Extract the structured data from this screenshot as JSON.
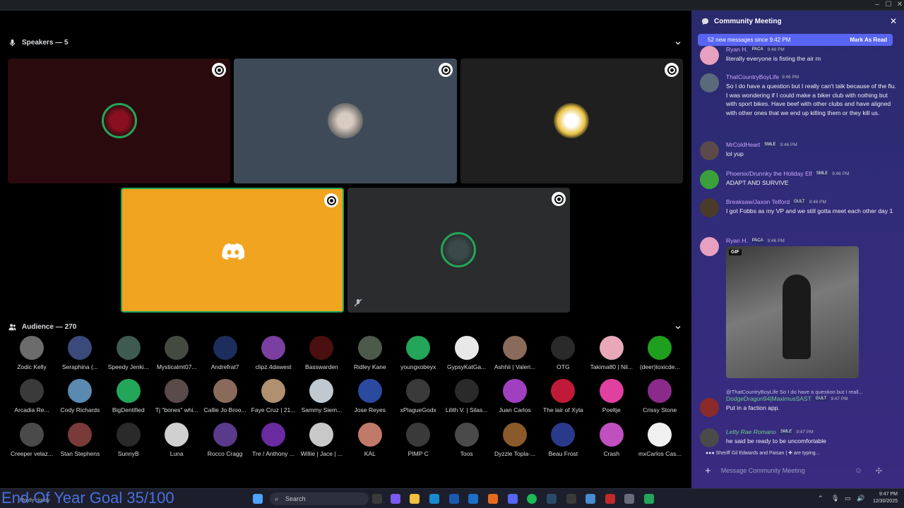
{
  "window": {
    "controls": [
      "–",
      "☐",
      "✕"
    ]
  },
  "speakers": {
    "label": "Speakers — 5"
  },
  "audience": {
    "label": "Audience — 270",
    "members": [
      {
        "name": "Zodic Kelly",
        "color": "#6c6c6c"
      },
      {
        "name": "Seraphina (...",
        "color": "#3a4a7a"
      },
      {
        "name": "Speedy Jenki...",
        "color": "#3f5a50"
      },
      {
        "name": "Mysticalmt07...",
        "color": "#444a40"
      },
      {
        "name": "Andrefrat7",
        "color": "#1d2d5c"
      },
      {
        "name": "clipz.4dawest",
        "color": "#7a3fa0"
      },
      {
        "name": "Basswarden",
        "color": "#4a1010"
      },
      {
        "name": "Ridley Kane",
        "color": "#4c5a4c"
      },
      {
        "name": "youngxobeyx",
        "color": "#23a55a"
      },
      {
        "name": "GypsyKatGa...",
        "color": "#e8e8e8"
      },
      {
        "name": "Ashhii | Valeri...",
        "color": "#8a6a5a"
      },
      {
        "name": "OTG",
        "color": "#2a2a2a"
      },
      {
        "name": "Takima80 | Nil...",
        "color": "#e8a8b8"
      },
      {
        "name": "(deer)toxicde...",
        "color": "#1ea01e"
      },
      {
        "name": "Arcadia Re...",
        "color": "#3a3a3a"
      },
      {
        "name": "Cody Richards",
        "color": "#5a8ab0"
      },
      {
        "name": "BigDentified",
        "color": "#23a55a"
      },
      {
        "name": "Tj \"bones\" whi...",
        "color": "#5a4a4a"
      },
      {
        "name": "Callie Jo Broo...",
        "color": "#8a6a5a"
      },
      {
        "name": "Faye Cruz | 21...",
        "color": "#b09070"
      },
      {
        "name": "Sammy Siem...",
        "color": "#c0c8d0"
      },
      {
        "name": "Jose Reyes",
        "color": "#2a4aa0"
      },
      {
        "name": "xPlagueGodx",
        "color": "#3a3a3a"
      },
      {
        "name": "Lilith V. | Silas...",
        "color": "#2a2a2a"
      },
      {
        "name": "Juan Carlos",
        "color": "#a040c0"
      },
      {
        "name": "The lair of Xyla",
        "color": "#c01a3a"
      },
      {
        "name": "Poeltje",
        "color": "#e040a0"
      },
      {
        "name": "Crissy Stone",
        "color": "#8a2a8a"
      },
      {
        "name": "Creeper velaz...",
        "color": "#4a4a4a"
      },
      {
        "name": "Stan Stephens",
        "color": "#7a3a3a"
      },
      {
        "name": "SunnyB",
        "color": "#2a2a2a"
      },
      {
        "name": "Luna",
        "color": "#d0d0d0"
      },
      {
        "name": "Rocco Cragg",
        "color": "#5a3a8a"
      },
      {
        "name": "Tre / Anthony ...",
        "color": "#6a2aa0"
      },
      {
        "name": "Willie | Jace | ...",
        "color": "#c8c8c8"
      },
      {
        "name": "KAL",
        "color": "#c07a6a"
      },
      {
        "name": "PIMP C",
        "color": "#3a3a3a"
      },
      {
        "name": "Toos",
        "color": "#4a4a4a"
      },
      {
        "name": "Dyzzle Topla-...",
        "color": "#8a5a2a"
      },
      {
        "name": "Beau Frost",
        "color": "#2a3a8a"
      },
      {
        "name": "Crash",
        "color": "#c050c0"
      },
      {
        "name": "mxCarlos Cas...",
        "color": "#f0f0f0"
      }
    ]
  },
  "chat": {
    "title": "Community Meeting",
    "new_messages": "52 new messages since 9:42 PM",
    "mark_read": "Mark As Read",
    "messages": [
      {
        "author": "Ryan H.",
        "tag": "PACA",
        "time": "9:46 PM",
        "text": "literally everyone is fisting the air rn",
        "color": "#e8a0c0"
      },
      {
        "author": "ThatCountryBoyLife",
        "tag": "",
        "time": "9:46 PM",
        "text": "So I do have a question but I really can't talk because of the flu. I was wondering if I could make a biker club with nothing but with sport bikes. Have beef with other clubs and have aligned with other ones that we end up killing them or they kill us.",
        "color": "#5a6a7a"
      },
      {
        "author": "MrColdHeart",
        "tag": "SMLE",
        "time": "9:46 PM",
        "text": "lol yup",
        "color": "#5a4a4a"
      },
      {
        "author": "Phoenix/Drunnky the Holiday Elf",
        "tag": "SMLE",
        "time": "9:46 PM",
        "text": "ADAPT AND SURVIVE",
        "color": "#3aa03a"
      },
      {
        "author": "Breaksaw/Jaxon Telford",
        "tag": "GULT",
        "time": "9:46 PM",
        "text": "I got Fobbs as my VP and we still gotta meet each other day 1",
        "color": "#4a3a2a"
      },
      {
        "author": "Ryan H.",
        "tag": "PACA",
        "time": "9:46 PM",
        "text": "GIF",
        "color": "#e8a0c0"
      },
      {
        "author": "DodgeDragon94|MaximusSAST",
        "tag": "GULT",
        "time": "9:47 PM",
        "text": "Put in a faction app.",
        "color": "#8a2a2a",
        "reply": "@ThatCountryBoyLife So I do have a question but I reall..."
      },
      {
        "author": "Letty Rae Romano",
        "tag": "SMLE",
        "time": "9:47 PM",
        "text": "he said be ready to be uncomfortable",
        "color": "#4a4a4a"
      }
    ],
    "typing": "Sheriff Gil Edwards and Paisan | ✚ are typing...",
    "composer_placeholder": "Message Community Meeting"
  },
  "taskbar": {
    "search": "Search",
    "time": "9:47 PM",
    "date": "12/30/2025",
    "weather": "Mostly cloudy"
  },
  "overlay_text": "End Of Year Goal 35/100"
}
